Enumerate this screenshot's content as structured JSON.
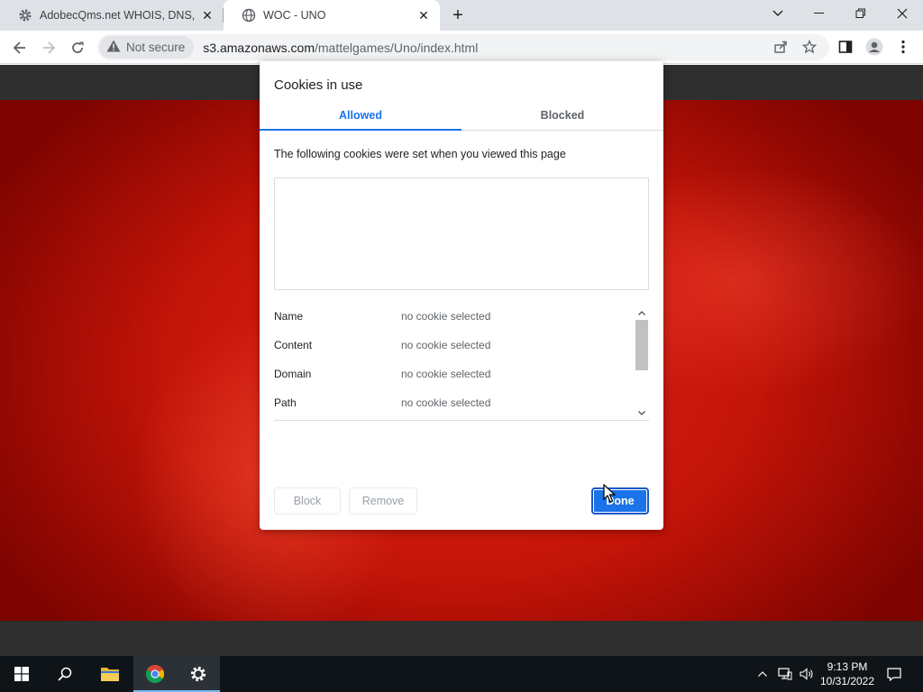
{
  "browser": {
    "tabs": [
      {
        "title": "AdobecQms.net WHOIS, DNS, &",
        "icon": "gear-icon"
      },
      {
        "title": "WOC - UNO",
        "icon": "globe-icon"
      }
    ],
    "security_chip": "Not secure",
    "url_host": "s3.amazonaws.com",
    "url_path": "/mattelgames/Uno/index.html"
  },
  "dialog": {
    "title": "Cookies in use",
    "tabs": [
      "Allowed",
      "Blocked"
    ],
    "active_tab": "Allowed",
    "description": "The following cookies were set when you viewed this page",
    "details": [
      {
        "label": "Name",
        "value": "no cookie selected"
      },
      {
        "label": "Content",
        "value": "no cookie selected"
      },
      {
        "label": "Domain",
        "value": "no cookie selected"
      },
      {
        "label": "Path",
        "value": "no cookie selected"
      }
    ],
    "buttons": {
      "block": "Block",
      "remove": "Remove",
      "done": "Done"
    }
  },
  "taskbar": {
    "time": "9:13 PM",
    "date": "10/31/2022"
  },
  "colors": {
    "accent": "#1a73e8",
    "page_red": "#d41a10",
    "taskbar": "#0f1419"
  }
}
